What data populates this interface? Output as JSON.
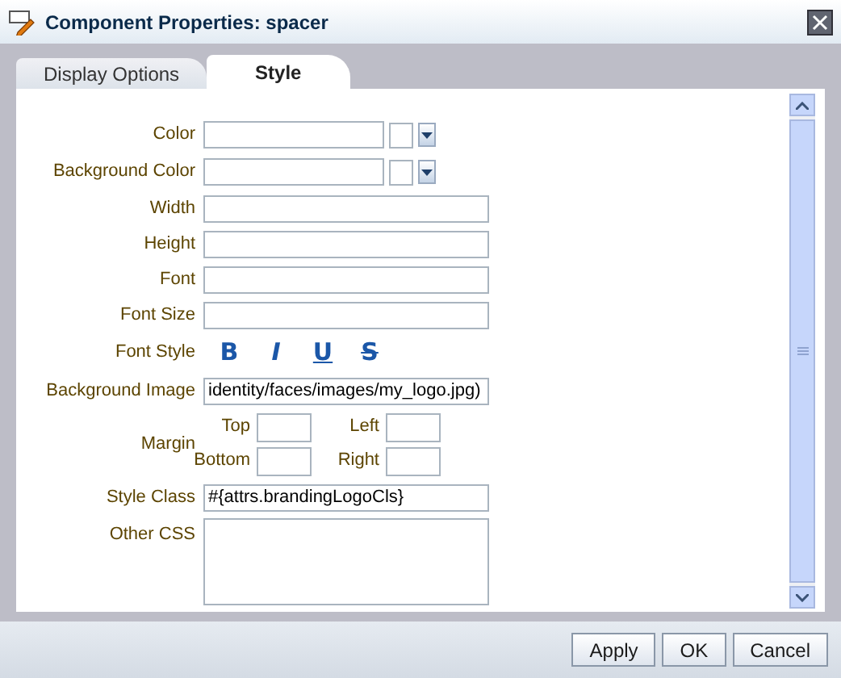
{
  "window": {
    "title": "Component Properties: spacer"
  },
  "tabs": [
    {
      "label": "Display Options",
      "selected": false
    },
    {
      "label": "Style",
      "selected": true
    }
  ],
  "fields": [
    {
      "kind": "color",
      "label": "Color"
    },
    {
      "kind": "color",
      "label": "Background Color"
    },
    {
      "kind": "text",
      "label": "Width"
    },
    {
      "kind": "text",
      "label": "Height"
    },
    {
      "kind": "text",
      "label": "Font"
    },
    {
      "kind": "text",
      "label": "Font Size"
    },
    {
      "kind": "font_style",
      "label": "Font Style",
      "buttons": [
        "B",
        "I",
        "U",
        "S"
      ]
    },
    {
      "kind": "text",
      "label": "Background Image",
      "value": "identity/faces/images/my_logo.jpg)"
    },
    {
      "kind": "margin",
      "label": "Margin",
      "sides": [
        {
          "label": "Top"
        },
        {
          "label": "Left"
        },
        {
          "label": "Bottom"
        },
        {
          "label": "Right"
        }
      ]
    },
    {
      "kind": "text",
      "label": "Style Class",
      "value": "#{attrs.brandingLogoCls}"
    },
    {
      "kind": "textarea",
      "label": "Other CSS"
    }
  ],
  "buttons": [
    "Apply",
    "OK",
    "Cancel"
  ]
}
